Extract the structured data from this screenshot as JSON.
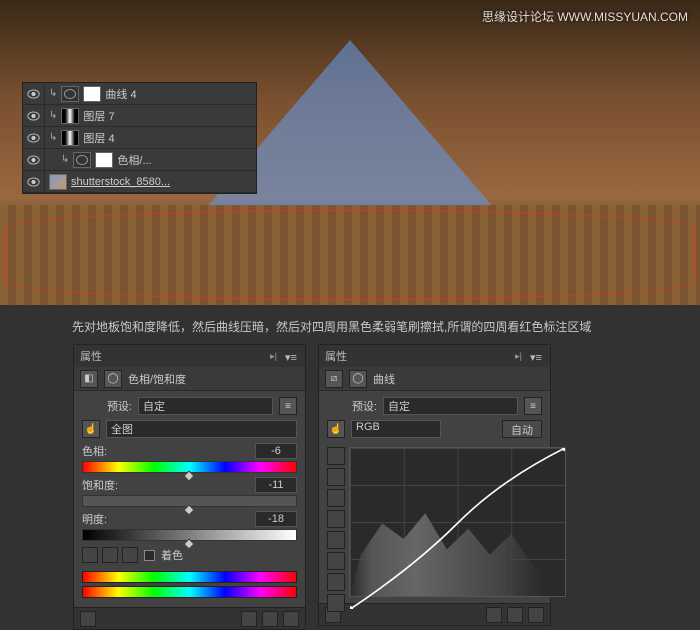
{
  "watermark": "思缘设计论坛 WWW.MISSYUAN.COM",
  "layers": [
    {
      "name": "曲线 4",
      "indent": 1,
      "thumb": "adj",
      "mask": "white"
    },
    {
      "name": "图层 7",
      "indent": 1,
      "thumb": "mask2",
      "mask": "mask2"
    },
    {
      "name": "图层 4",
      "indent": 1,
      "thumb": "mask2",
      "mask": "mask2"
    },
    {
      "name": "色相/...",
      "indent": 2,
      "thumb": "adj",
      "mask": "white"
    },
    {
      "name": "shutterstock_8580...",
      "indent": 1,
      "thumb": "img",
      "underline": true
    }
  ],
  "caption": "先对地板饱和度降低，然后曲线压暗，然后对四周用黑色柔弱笔刷擦拭,所谓的四周看红色标注区域",
  "props_label": "属性",
  "hsl": {
    "title": "色相/饱和度",
    "preset_label": "预设:",
    "preset_value": "自定",
    "range_label": "全图",
    "hue_label": "色相:",
    "hue_value": "-6",
    "sat_label": "饱和度:",
    "sat_value": "-11",
    "light_label": "明度:",
    "light_value": "-18",
    "colorize_label": "着色"
  },
  "curves": {
    "title": "曲线",
    "preset_label": "预设:",
    "preset_value": "自定",
    "channel": "RGB",
    "auto_btn": "自动"
  }
}
